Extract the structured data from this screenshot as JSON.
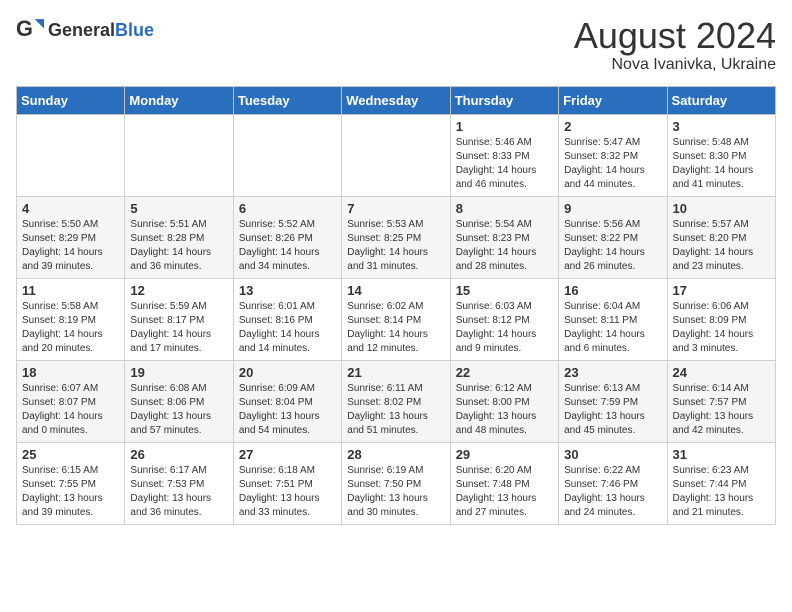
{
  "header": {
    "logo_general": "General",
    "logo_blue": "Blue",
    "month": "August 2024",
    "location": "Nova Ivanivka, Ukraine"
  },
  "weekdays": [
    "Sunday",
    "Monday",
    "Tuesday",
    "Wednesday",
    "Thursday",
    "Friday",
    "Saturday"
  ],
  "weeks": [
    [
      {
        "day": "",
        "info": ""
      },
      {
        "day": "",
        "info": ""
      },
      {
        "day": "",
        "info": ""
      },
      {
        "day": "",
        "info": ""
      },
      {
        "day": "1",
        "info": "Sunrise: 5:46 AM\nSunset: 8:33 PM\nDaylight: 14 hours and 46 minutes."
      },
      {
        "day": "2",
        "info": "Sunrise: 5:47 AM\nSunset: 8:32 PM\nDaylight: 14 hours and 44 minutes."
      },
      {
        "day": "3",
        "info": "Sunrise: 5:48 AM\nSunset: 8:30 PM\nDaylight: 14 hours and 41 minutes."
      }
    ],
    [
      {
        "day": "4",
        "info": "Sunrise: 5:50 AM\nSunset: 8:29 PM\nDaylight: 14 hours and 39 minutes."
      },
      {
        "day": "5",
        "info": "Sunrise: 5:51 AM\nSunset: 8:28 PM\nDaylight: 14 hours and 36 minutes."
      },
      {
        "day": "6",
        "info": "Sunrise: 5:52 AM\nSunset: 8:26 PM\nDaylight: 14 hours and 34 minutes."
      },
      {
        "day": "7",
        "info": "Sunrise: 5:53 AM\nSunset: 8:25 PM\nDaylight: 14 hours and 31 minutes."
      },
      {
        "day": "8",
        "info": "Sunrise: 5:54 AM\nSunset: 8:23 PM\nDaylight: 14 hours and 28 minutes."
      },
      {
        "day": "9",
        "info": "Sunrise: 5:56 AM\nSunset: 8:22 PM\nDaylight: 14 hours and 26 minutes."
      },
      {
        "day": "10",
        "info": "Sunrise: 5:57 AM\nSunset: 8:20 PM\nDaylight: 14 hours and 23 minutes."
      }
    ],
    [
      {
        "day": "11",
        "info": "Sunrise: 5:58 AM\nSunset: 8:19 PM\nDaylight: 14 hours and 20 minutes."
      },
      {
        "day": "12",
        "info": "Sunrise: 5:59 AM\nSunset: 8:17 PM\nDaylight: 14 hours and 17 minutes."
      },
      {
        "day": "13",
        "info": "Sunrise: 6:01 AM\nSunset: 8:16 PM\nDaylight: 14 hours and 14 minutes."
      },
      {
        "day": "14",
        "info": "Sunrise: 6:02 AM\nSunset: 8:14 PM\nDaylight: 14 hours and 12 minutes."
      },
      {
        "day": "15",
        "info": "Sunrise: 6:03 AM\nSunset: 8:12 PM\nDaylight: 14 hours and 9 minutes."
      },
      {
        "day": "16",
        "info": "Sunrise: 6:04 AM\nSunset: 8:11 PM\nDaylight: 14 hours and 6 minutes."
      },
      {
        "day": "17",
        "info": "Sunrise: 6:06 AM\nSunset: 8:09 PM\nDaylight: 14 hours and 3 minutes."
      }
    ],
    [
      {
        "day": "18",
        "info": "Sunrise: 6:07 AM\nSunset: 8:07 PM\nDaylight: 14 hours and 0 minutes."
      },
      {
        "day": "19",
        "info": "Sunrise: 6:08 AM\nSunset: 8:06 PM\nDaylight: 13 hours and 57 minutes."
      },
      {
        "day": "20",
        "info": "Sunrise: 6:09 AM\nSunset: 8:04 PM\nDaylight: 13 hours and 54 minutes."
      },
      {
        "day": "21",
        "info": "Sunrise: 6:11 AM\nSunset: 8:02 PM\nDaylight: 13 hours and 51 minutes."
      },
      {
        "day": "22",
        "info": "Sunrise: 6:12 AM\nSunset: 8:00 PM\nDaylight: 13 hours and 48 minutes."
      },
      {
        "day": "23",
        "info": "Sunrise: 6:13 AM\nSunset: 7:59 PM\nDaylight: 13 hours and 45 minutes."
      },
      {
        "day": "24",
        "info": "Sunrise: 6:14 AM\nSunset: 7:57 PM\nDaylight: 13 hours and 42 minutes."
      }
    ],
    [
      {
        "day": "25",
        "info": "Sunrise: 6:15 AM\nSunset: 7:55 PM\nDaylight: 13 hours and 39 minutes."
      },
      {
        "day": "26",
        "info": "Sunrise: 6:17 AM\nSunset: 7:53 PM\nDaylight: 13 hours and 36 minutes."
      },
      {
        "day": "27",
        "info": "Sunrise: 6:18 AM\nSunset: 7:51 PM\nDaylight: 13 hours and 33 minutes."
      },
      {
        "day": "28",
        "info": "Sunrise: 6:19 AM\nSunset: 7:50 PM\nDaylight: 13 hours and 30 minutes."
      },
      {
        "day": "29",
        "info": "Sunrise: 6:20 AM\nSunset: 7:48 PM\nDaylight: 13 hours and 27 minutes."
      },
      {
        "day": "30",
        "info": "Sunrise: 6:22 AM\nSunset: 7:46 PM\nDaylight: 13 hours and 24 minutes."
      },
      {
        "day": "31",
        "info": "Sunrise: 6:23 AM\nSunset: 7:44 PM\nDaylight: 13 hours and 21 minutes."
      }
    ]
  ]
}
